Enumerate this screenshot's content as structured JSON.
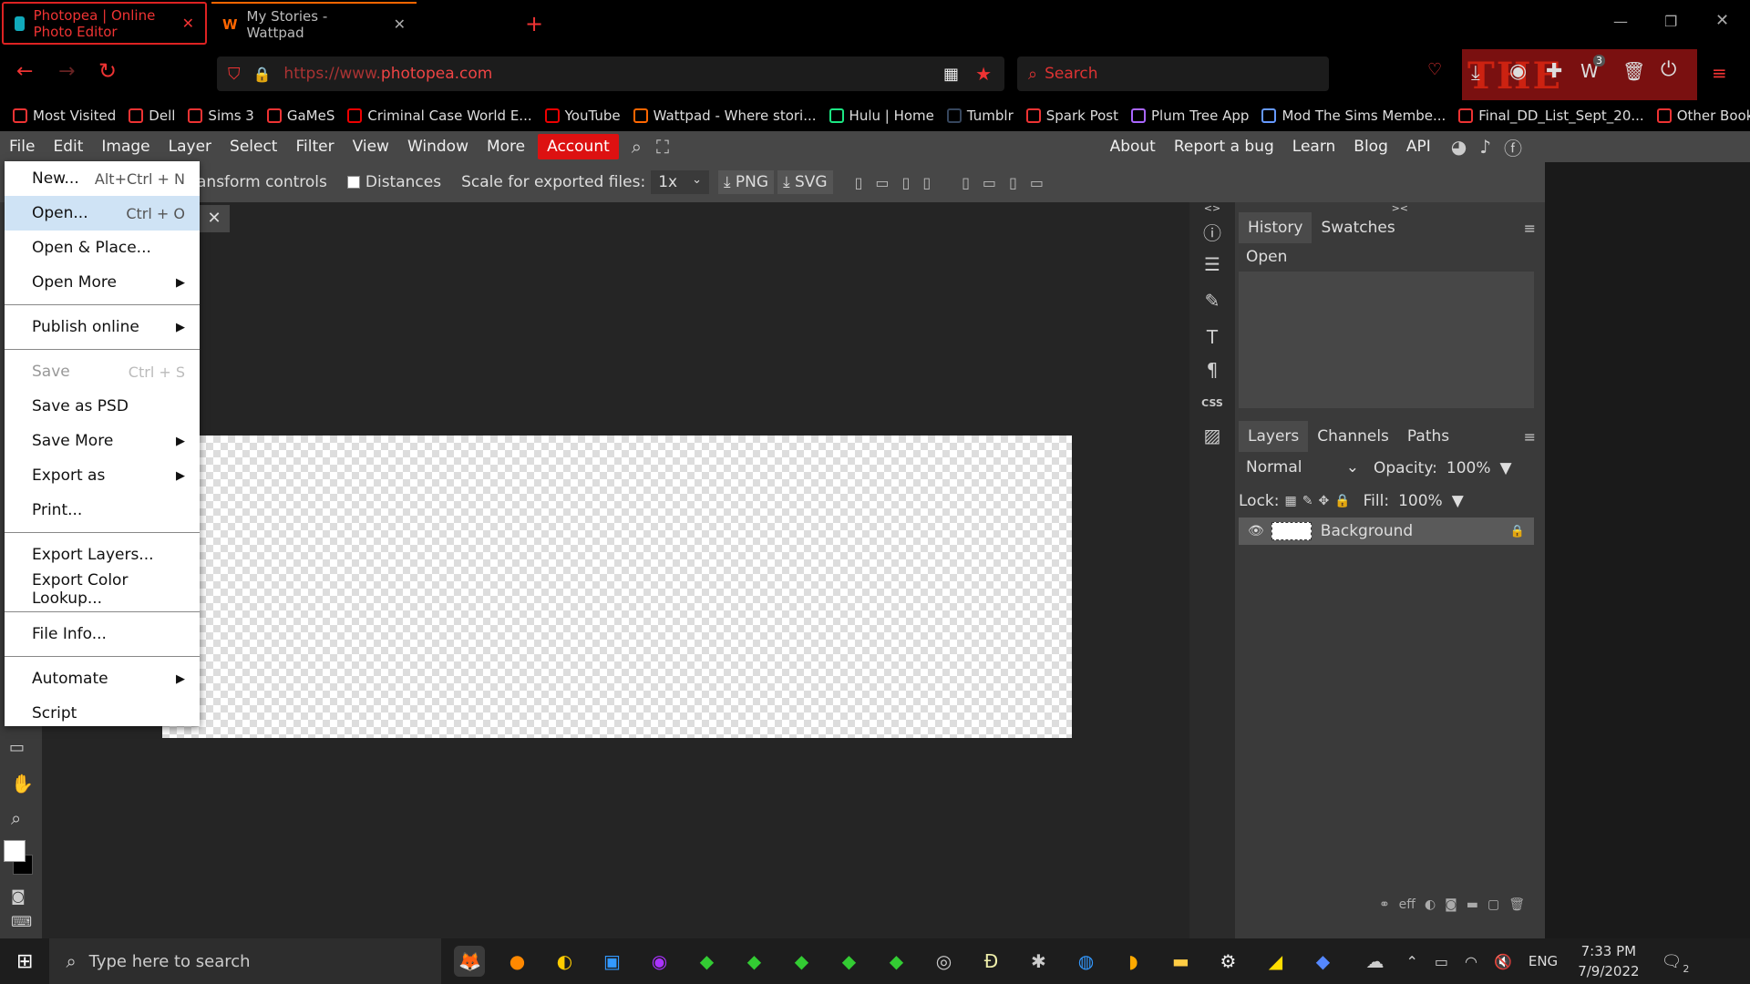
{
  "browser": {
    "tabs": [
      {
        "label": "Photopea | Online Photo Editor",
        "active": true
      },
      {
        "label": "My Stories - Wattpad",
        "active": false
      }
    ],
    "new_tab_icon": "plus-icon",
    "url_prefix": "https://www.",
    "url_domain": "photopea.com",
    "search_placeholder": "Search",
    "badge_count": "3",
    "theme_text": "THE BATMAN",
    "bookmarks": [
      {
        "label": "Most Visited",
        "icon": "gear-icon",
        "color": "#e33"
      },
      {
        "label": "Dell",
        "icon": "folder-icon",
        "color": "#e33"
      },
      {
        "label": "Sims 3",
        "icon": "folder-icon",
        "color": "#e33"
      },
      {
        "label": "GaMeS",
        "icon": "folder-icon",
        "color": "#e33"
      },
      {
        "label": "Criminal Case World E...",
        "icon": "youtube-icon",
        "color": "#e00"
      },
      {
        "label": "YouTube",
        "icon": "youtube-icon",
        "color": "#e00"
      },
      {
        "label": "Wattpad - Where stori...",
        "icon": "wattpad-icon",
        "color": "#f60"
      },
      {
        "label": "Hulu | Home",
        "icon": "hulu-icon",
        "color": "#1ce783"
      },
      {
        "label": "Tumblr",
        "icon": "tumblr-icon",
        "color": "#36465d"
      },
      {
        "label": "Spark Post",
        "icon": "globe-icon",
        "color": "#e33"
      },
      {
        "label": "Plum Tree App",
        "icon": "diamond-icon",
        "color": "#a6f"
      },
      {
        "label": "Mod The Sims Membe...",
        "icon": "image-icon",
        "color": "#69f"
      },
      {
        "label": "Final_DD_List_Sept_20...",
        "icon": "globe-icon",
        "color": "#e33"
      },
      {
        "label": "Other Bookmarks",
        "icon": "folder-icon",
        "color": "#e33"
      }
    ]
  },
  "app": {
    "menu": [
      "File",
      "Edit",
      "Image",
      "Layer",
      "Select",
      "Filter",
      "View",
      "Window",
      "More"
    ],
    "account_label": "Account",
    "right_links": [
      "About",
      "Report a bug",
      "Learn",
      "Blog",
      "API"
    ],
    "toolbar": {
      "transform_label": "ansform controls",
      "distances_label": "Distances",
      "scale_label": "Scale for exported files:",
      "scale_value": "1x",
      "png_label": "PNG",
      "svg_label": "SVG"
    },
    "file_menu": [
      {
        "label": "New...",
        "shortcut": "Alt+Ctrl + N"
      },
      {
        "label": "Open...",
        "shortcut": "Ctrl + O",
        "highlight": true
      },
      {
        "label": "Open & Place..."
      },
      {
        "label": "Open More",
        "submenu": true
      },
      {
        "sep": true
      },
      {
        "label": "Publish online",
        "submenu": true
      },
      {
        "sep": true
      },
      {
        "label": "Save",
        "shortcut": "Ctrl + S",
        "disabled": true
      },
      {
        "label": "Save as PSD"
      },
      {
        "label": "Save More",
        "submenu": true
      },
      {
        "label": "Export as",
        "submenu": true
      },
      {
        "label": "Print..."
      },
      {
        "sep": true
      },
      {
        "label": "Export Layers..."
      },
      {
        "label": "Export Color Lookup..."
      },
      {
        "sep": true
      },
      {
        "label": "File Info..."
      },
      {
        "sep": true
      },
      {
        "label": "Automate",
        "submenu": true
      },
      {
        "label": "Script"
      }
    ],
    "history_tabs": [
      "History",
      "Swatches"
    ],
    "history_items": [
      "Open"
    ],
    "layers_tabs": [
      "Layers",
      "Channels",
      "Paths"
    ],
    "blend_mode": "Normal",
    "opacity_label": "Opacity:",
    "opacity_value": "100%",
    "lock_label": "Lock:",
    "fill_label": "Fill:",
    "fill_value": "100%",
    "layers": [
      {
        "name": "Background",
        "visible": true,
        "locked": true
      }
    ],
    "panel_collapse_left": "<>",
    "panel_collapse_right": "><",
    "css_label": "CSS",
    "layer_footer_eff": "eff"
  },
  "taskbar": {
    "search_placeholder": "Type here to search",
    "time": "7:33 PM",
    "date": "7/9/2022",
    "lang": "ENG",
    "notif_count": "2"
  },
  "colors": {
    "accent": "#e33",
    "panel": "#474747",
    "menu_highlight": "#cfe3f5"
  }
}
